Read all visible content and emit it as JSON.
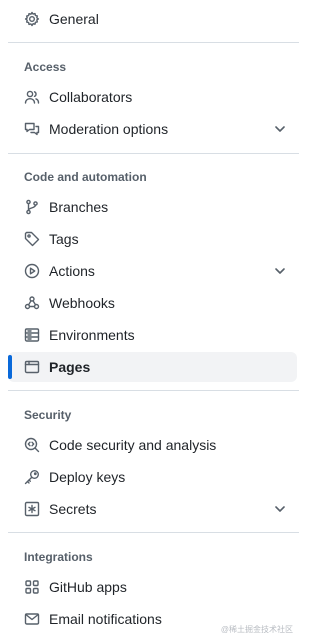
{
  "nav": {
    "general": "General",
    "sections": {
      "access": "Access",
      "code": "Code and automation",
      "security": "Security",
      "integrations": "Integrations"
    },
    "items": {
      "collaborators": "Collaborators",
      "moderation": "Moderation options",
      "branches": "Branches",
      "tags": "Tags",
      "actions": "Actions",
      "webhooks": "Webhooks",
      "environments": "Environments",
      "pages": "Pages",
      "code_security": "Code security and analysis",
      "deploy_keys": "Deploy keys",
      "secrets": "Secrets",
      "github_apps": "GitHub apps",
      "email_notifications": "Email notifications"
    },
    "active_item": "Pages"
  },
  "watermark": "@稀土掘金技术社区",
  "colors": {
    "accent": "#0969da",
    "active_bg": "#f2f3f5",
    "text": "#1f2328",
    "muted": "#57606a",
    "divider": "#d8dee4"
  },
  "icons": {
    "general": "gear-icon",
    "collaborators": "people-icon",
    "moderation": "comment-discussion-icon",
    "branches": "git-branch-icon",
    "tags": "tag-icon",
    "actions": "play-icon",
    "webhooks": "webhook-icon",
    "environments": "server-icon",
    "pages": "browser-icon",
    "code_security": "codescan-icon",
    "deploy_keys": "key-icon",
    "secrets": "asterisk-icon",
    "github_apps": "apps-icon",
    "email_notifications": "mail-icon",
    "expand": "chevron-down-icon"
  }
}
